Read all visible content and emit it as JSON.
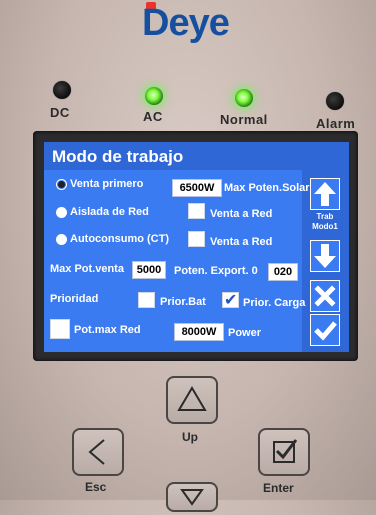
{
  "brand": {
    "name": "Deye"
  },
  "indicators": [
    {
      "label": "DC",
      "state": "off"
    },
    {
      "label": "AC",
      "state": "on"
    },
    {
      "label": "Normal",
      "state": "on"
    },
    {
      "label": "Alarm",
      "state": "off"
    }
  ],
  "screen": {
    "title": "Modo de trabajo",
    "modes": [
      {
        "label": "Venta primero",
        "selected": false
      },
      {
        "label": "Aislada de Red",
        "selected": true
      },
      {
        "label": "Autoconsumo (CT)",
        "selected": true
      }
    ],
    "max_solar": {
      "value": "6500W",
      "label": "Max Poten.Solar"
    },
    "venta_a_red_1": {
      "label": "Venta a Red",
      "checked": false
    },
    "venta_a_red_2": {
      "label": "Venta a Red",
      "checked": false
    },
    "max_pot_venta": {
      "label": "Max Pot.venta",
      "value": "5000"
    },
    "poten_export": {
      "label": "Poten. Export. 0",
      "value": "020"
    },
    "prioridad": {
      "label": "Prioridad"
    },
    "prior_bat": {
      "label": "Prior.Bat",
      "checked": false
    },
    "prior_carga": {
      "label": "Prior. Carga",
      "checked": true
    },
    "pot_max_red": {
      "label": "Pot.max Red",
      "checked": false
    },
    "power": {
      "value": "8000W",
      "label": "Power"
    },
    "side": {
      "mode_label_1": "Trab",
      "mode_label_2": "Modo1"
    }
  },
  "keys": {
    "up": "Up",
    "esc": "Esc",
    "enter": "Enter"
  },
  "colors": {
    "screen_bg": "#3a7bf2",
    "title_bg": "#2f67d6",
    "led_on": "#7bff3a",
    "brand": "#174f9f"
  }
}
